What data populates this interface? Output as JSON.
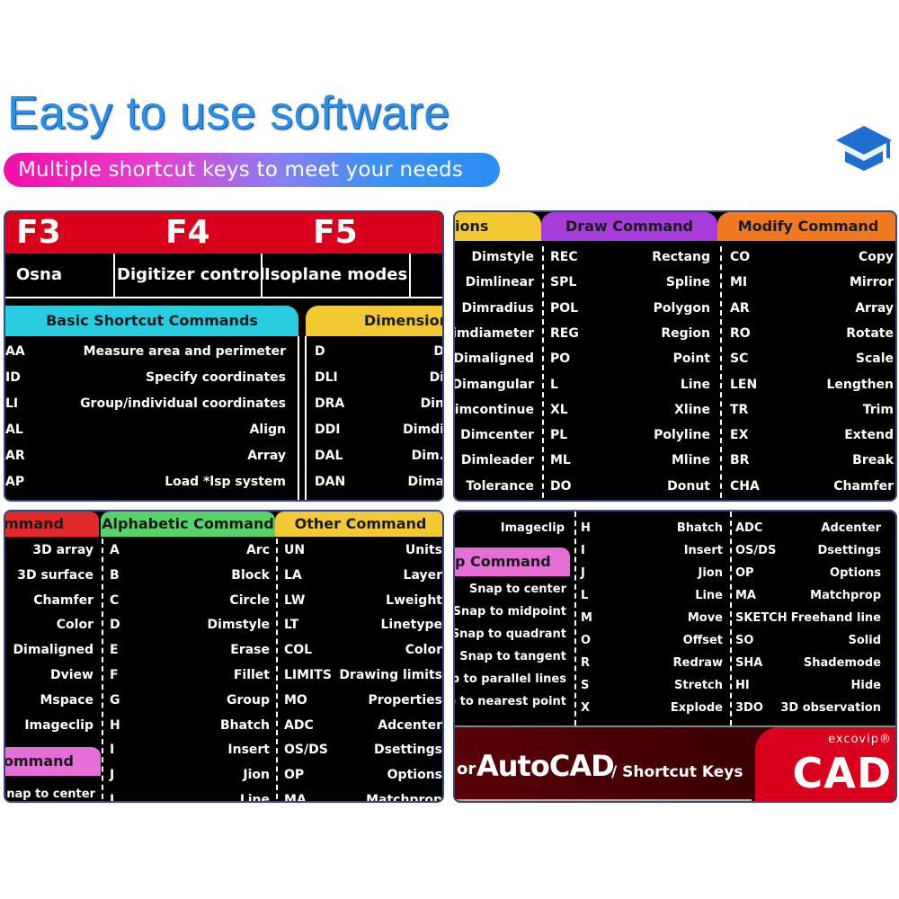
{
  "header": {
    "headline": "Easy to use software",
    "subheadline": "Multiple shortcut keys to meet your needs",
    "icon": "graduation-cap-icon",
    "colors": {
      "headline": "#2a8fe6",
      "pill_start": "#f20fa8",
      "pill_end": "#2a8ef2",
      "icon": "#1f6fd0"
    }
  },
  "panel1": {
    "fkeys": [
      {
        "key": "F3",
        "desc": "Osna"
      },
      {
        "key": "F4",
        "desc": "Digitizer control"
      },
      {
        "key": "F5",
        "desc": "Isoplane modes"
      }
    ],
    "basic_tab": "Basic Shortcut Commands",
    "dimension_tab": "Dimension",
    "basic_rows": [
      {
        "key": "AA",
        "value": "Measure area and perimeter"
      },
      {
        "key": "ID",
        "value": "Specify coordinates"
      },
      {
        "key": "LI",
        "value": "Group/individual coordinates"
      },
      {
        "key": "AL",
        "value": "Align"
      },
      {
        "key": "AR",
        "value": "Array"
      },
      {
        "key": "AP",
        "value": "Load *lsp system"
      }
    ],
    "dimension_rows": [
      {
        "key": "D",
        "value": "D"
      },
      {
        "key": "DLI",
        "value": "Di"
      },
      {
        "key": "DRA",
        "value": "Din"
      },
      {
        "key": "DDI",
        "value": "Dimdi"
      },
      {
        "key": "DAL",
        "value": "Dim."
      },
      {
        "key": "DAN",
        "value": "Dima"
      }
    ]
  },
  "panel2": {
    "tabs": {
      "dimension": "ions",
      "draw": "Draw Command",
      "modify": "Modify Command"
    },
    "dimension_values": [
      "Dimstyle",
      "Dimlinear",
      "Dimradius",
      "imdiameter",
      "Dimaligned",
      "Dimangular",
      "imcontinue",
      "Dimcenter",
      "Dimleader",
      "Tolerance"
    ],
    "draw_rows": [
      {
        "key": "REC",
        "value": "Rectang"
      },
      {
        "key": "SPL",
        "value": "Spline"
      },
      {
        "key": "POL",
        "value": "Polygon"
      },
      {
        "key": "REG",
        "value": "Region"
      },
      {
        "key": "PO",
        "value": "Point"
      },
      {
        "key": "L",
        "value": "Line"
      },
      {
        "key": "XL",
        "value": "Xline"
      },
      {
        "key": "PL",
        "value": "Polyline"
      },
      {
        "key": "ML",
        "value": "Mline"
      },
      {
        "key": "DO",
        "value": "Donut"
      }
    ],
    "modify_rows": [
      {
        "key": "CO",
        "value": "Copy"
      },
      {
        "key": "MI",
        "value": "Mirror"
      },
      {
        "key": "AR",
        "value": "Array"
      },
      {
        "key": "RO",
        "value": "Rotate"
      },
      {
        "key": "SC",
        "value": "Scale"
      },
      {
        "key": "LEN",
        "value": "Lengthen"
      },
      {
        "key": "TR",
        "value": "Trim"
      },
      {
        "key": "EX",
        "value": "Extend"
      },
      {
        "key": "BR",
        "value": "Break"
      },
      {
        "key": "CHA",
        "value": "Chamfer"
      }
    ]
  },
  "panel3": {
    "tabs": {
      "three_d": "mmand",
      "alpha": "Alphabetic Command",
      "other": "Other Command",
      "osnap": "ommand"
    },
    "three_d_values": [
      "3D array",
      "3D surface",
      "Chamfer",
      "Color",
      "Dimaligned",
      "Dview",
      "Mspace",
      "Imageclip"
    ],
    "osnap_values": [
      "Snap to center"
    ],
    "alpha_rows": [
      {
        "key": "A",
        "value": "Arc"
      },
      {
        "key": "B",
        "value": "Block"
      },
      {
        "key": "C",
        "value": "Circle"
      },
      {
        "key": "D",
        "value": "Dimstyle"
      },
      {
        "key": "E",
        "value": "Erase"
      },
      {
        "key": "F",
        "value": "Fillet"
      },
      {
        "key": "G",
        "value": "Group"
      },
      {
        "key": "H",
        "value": "Bhatch"
      },
      {
        "key": "I",
        "value": "Insert"
      },
      {
        "key": "J",
        "value": "Jion"
      },
      {
        "key": "L",
        "value": "Line"
      }
    ],
    "other_rows": [
      {
        "key": "UN",
        "value": "Units"
      },
      {
        "key": "LA",
        "value": "Layer"
      },
      {
        "key": "LW",
        "value": "Lweight"
      },
      {
        "key": "LT",
        "value": "Linetype"
      },
      {
        "key": "COL",
        "value": "Color"
      },
      {
        "key": "LIMITS",
        "value": "Drawing limits"
      },
      {
        "key": "MO",
        "value": "Properties"
      },
      {
        "key": "ADC",
        "value": "Adcenter"
      },
      {
        "key": "OS/DS",
        "value": "Dsettings"
      },
      {
        "key": "OP",
        "value": "Options"
      },
      {
        "key": "MA",
        "value": "Matchprop"
      }
    ]
  },
  "panel4": {
    "osnap_tab": "p  Command",
    "left_top_value": "Imageclip",
    "osnap_values": [
      "Snap to center",
      "Snap to midpoint",
      "Snap to quadrant",
      "Snap to tangent",
      "nap to parallel lines",
      "nap to nearest point"
    ],
    "alpha_rows": [
      {
        "key": "H",
        "value": "Bhatch"
      },
      {
        "key": "I",
        "value": "Insert"
      },
      {
        "key": "J",
        "value": "Jion"
      },
      {
        "key": "L",
        "value": "Line"
      },
      {
        "key": "M",
        "value": "Move"
      },
      {
        "key": "O",
        "value": "Offset"
      },
      {
        "key": "R",
        "value": "Redraw"
      },
      {
        "key": "S",
        "value": "Stretch"
      },
      {
        "key": "X",
        "value": "Explode"
      }
    ],
    "other_rows": [
      {
        "key": "ADC",
        "value": "Adcenter"
      },
      {
        "key": "OS/DS",
        "value": "Dsettings"
      },
      {
        "key": "OP",
        "value": "Options"
      },
      {
        "key": "MA",
        "value": "Matchprop"
      },
      {
        "key": "SKETCH",
        "value": "Freehand line"
      },
      {
        "key": "SO",
        "value": "Solid"
      },
      {
        "key": "SHA",
        "value": "Shademode"
      },
      {
        "key": "HI",
        "value": "Hide"
      },
      {
        "key": "3DO",
        "value": "3D observation"
      }
    ],
    "footer": {
      "prefix": "or",
      "product": "AutoCAD",
      "suffix": "/ Shortcut Keys",
      "brand": "excovip®",
      "brand_mark": "CAD"
    }
  }
}
